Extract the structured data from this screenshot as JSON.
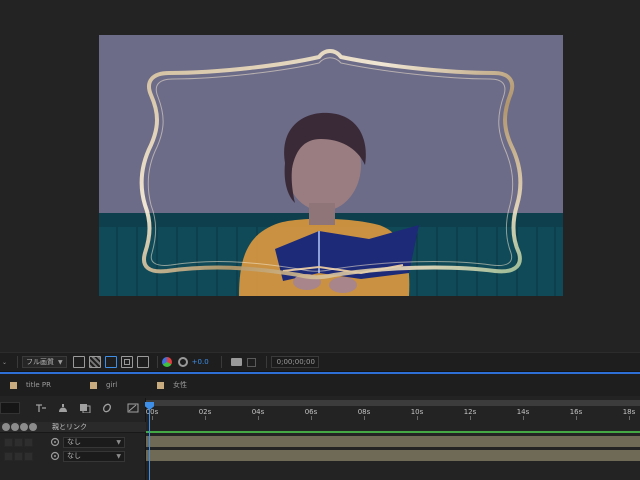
{
  "viewer_toolbar": {
    "resolution": "フル画質",
    "exposure": "+0.0",
    "timecode": "0;00;00;00"
  },
  "timeline": {
    "tabs": [
      {
        "label": "title PR",
        "color": "#c8ab7e"
      },
      {
        "label": "girl",
        "color": "#c8ab7e"
      },
      {
        "label": "女性",
        "color": "#c8ab7e"
      }
    ],
    "parent_header": "親とリンク",
    "layers": [
      {
        "parent": "なし"
      },
      {
        "parent": "なし"
      }
    ],
    "ruler_labels": [
      "00s",
      "02s",
      "04s",
      "06s",
      "08s",
      "10s",
      "12s",
      "14s",
      "16s",
      "18s"
    ]
  },
  "colors": {
    "accent": "#2d6fd4",
    "playhead": "#3d8fe8",
    "work_area": "#44a844",
    "layer_track": "#6e6a55"
  }
}
